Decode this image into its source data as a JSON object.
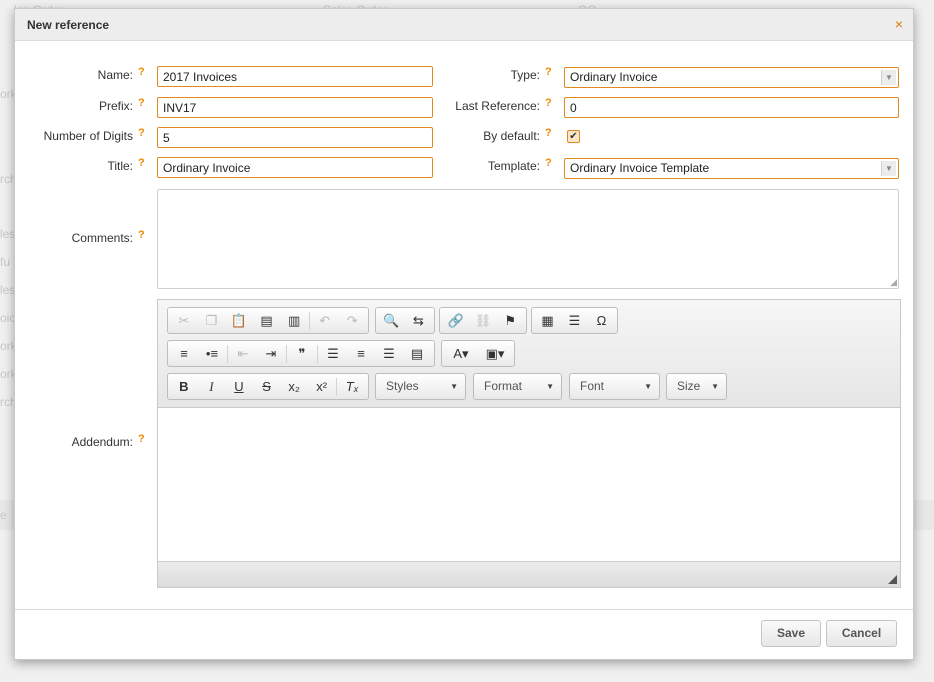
{
  "background": {
    "items": [
      "les Order",
      "Sales Order",
      "QO",
      "ork",
      "rch",
      "les",
      "fu",
      "les",
      "oic",
      "ork",
      "ork",
      "rch",
      "e"
    ]
  },
  "dialog": {
    "title": "New reference",
    "close_glyph": "×",
    "help_glyph": "?",
    "fields": {
      "name": {
        "label": "Name:",
        "value": "2017 Invoices"
      },
      "prefix": {
        "label": "Prefix:",
        "value": "INV17"
      },
      "digits": {
        "label": "Number of Digits",
        "value": "5"
      },
      "title": {
        "label": "Title:",
        "value": "Ordinary Invoice"
      },
      "type": {
        "label": "Type:",
        "value": "Ordinary Invoice"
      },
      "last_reference": {
        "label": "Last Reference:",
        "value": "0"
      },
      "by_default": {
        "label": "By default:",
        "checked": true
      },
      "template": {
        "label": "Template:",
        "value": "Ordinary Invoice Template"
      },
      "comments": {
        "label": "Comments:",
        "value": ""
      },
      "addendum": {
        "label": "Addendum:",
        "value": ""
      }
    },
    "editor": {
      "combos": {
        "styles": "Styles",
        "format": "Format",
        "font": "Font",
        "size": "Size"
      },
      "icons": [
        "cut-icon",
        "copy-icon",
        "paste-icon",
        "paste-text-icon",
        "paste-word-icon",
        "undo-icon",
        "redo-icon",
        "find-icon",
        "replace-icon",
        "link-icon",
        "unlink-icon",
        "anchor-icon",
        "table-icon",
        "horizontal-line-icon",
        "special-char-icon",
        "numbered-list-icon",
        "bulleted-list-icon",
        "outdent-icon",
        "indent-icon",
        "blockquote-icon",
        "align-left-icon",
        "align-center-icon",
        "align-right-icon",
        "justify-icon",
        "text-color-icon",
        "bg-color-icon",
        "bold-icon",
        "italic-icon",
        "underline-icon",
        "strike-icon",
        "subscript-icon",
        "superscript-icon",
        "remove-format-icon"
      ]
    },
    "buttons": {
      "save": "Save",
      "cancel": "Cancel"
    }
  },
  "colors": {
    "accent": "#f08a00",
    "field_border": "#e08a1e"
  }
}
